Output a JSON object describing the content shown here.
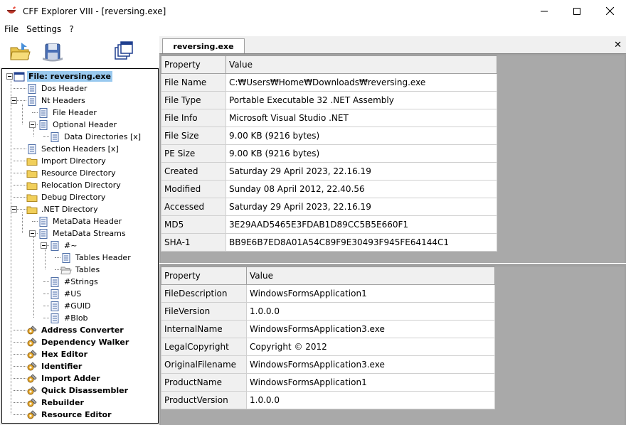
{
  "window": {
    "title": "CFF Explorer VIII - [reversing.exe]",
    "controls": {
      "minimize": "—",
      "maximize": "☐",
      "close": "✕"
    }
  },
  "menu": [
    "File",
    "Settings",
    "?"
  ],
  "toolbar": {
    "icons": [
      "open-folder-icon",
      "save-disk-icon",
      "windows-icon"
    ]
  },
  "tree": {
    "root": "File: reversing.exe",
    "items": [
      "Dos Header",
      "Nt Headers",
      "File Header",
      "Optional Header",
      "Data Directories [x]",
      "Section Headers [x]",
      "Import Directory",
      "Resource Directory",
      "Relocation Directory",
      "Debug Directory",
      ".NET Directory",
      "MetaData Header",
      "MetaData Streams",
      "#~",
      "Tables Header",
      "Tables",
      "#Strings",
      "#US",
      "#GUID",
      "#Blob"
    ],
    "tools": [
      "Address Converter",
      "Dependency Walker",
      "Hex Editor",
      "Identifier",
      "Import Adder",
      "Quick Disassembler",
      "Rebuilder",
      "Resource Editor"
    ]
  },
  "tab": {
    "label": "reversing.exe",
    "close": "✕"
  },
  "file_info": {
    "headers": [
      "Property",
      "Value"
    ],
    "rows": [
      [
        "File Name",
        "C:₩Users₩Home₩Downloads₩reversing.exe"
      ],
      [
        "File Type",
        "Portable Executable 32 .NET Assembly"
      ],
      [
        "File Info",
        "Microsoft Visual Studio .NET"
      ],
      [
        "File Size",
        "9.00 KB (9216 bytes)"
      ],
      [
        "PE Size",
        "9.00 KB (9216 bytes)"
      ],
      [
        "Created",
        "Saturday 29 April 2023, 22.16.19"
      ],
      [
        "Modified",
        "Sunday 08 April 2012, 22.40.56"
      ],
      [
        "Accessed",
        "Saturday 29 April 2023, 22.16.19"
      ],
      [
        "MD5",
        "3E29AAD5465E3FDAB1D89CC5B5E660F1"
      ],
      [
        "SHA-1",
        "BB9E6B7ED8A01A54C89F9E30493F945FE64144C1"
      ]
    ]
  },
  "version_info": {
    "headers": [
      "Property",
      "Value"
    ],
    "rows": [
      [
        "FileDescription",
        "WindowsFormsApplication1"
      ],
      [
        "FileVersion",
        "1.0.0.0"
      ],
      [
        "InternalName",
        "WindowsFormsApplication3.exe"
      ],
      [
        "LegalCopyright",
        "Copyright ©  2012"
      ],
      [
        "OriginalFilename",
        "WindowsFormsApplication3.exe"
      ],
      [
        "ProductName",
        "WindowsFormsApplication1"
      ],
      [
        "ProductVersion",
        "1.0.0.0"
      ]
    ]
  }
}
